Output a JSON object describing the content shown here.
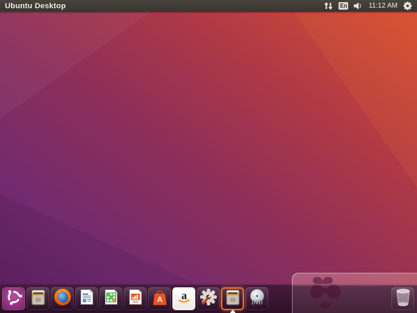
{
  "panel": {
    "title": "Ubuntu Desktop",
    "keyboard_layout": "En",
    "time": "11:12 AM",
    "bg_color": "#3C3833",
    "fg_color": "#F2F0EA"
  },
  "wallpaper": {
    "gradient_top_right": "#D8502F",
    "gradient_center": "#9B3355",
    "gradient_bottom_left": "#5E2160"
  },
  "launcher": {
    "bg_color": "#2C0F26",
    "accent_color": "#E95420",
    "software_letter": "A",
    "amazon_letter": "a",
    "dvd_text": "DVD",
    "items": [
      {
        "id": "dash-home"
      },
      {
        "id": "files"
      },
      {
        "id": "firefox"
      },
      {
        "id": "libreoffice-writer"
      },
      {
        "id": "libreoffice-calc"
      },
      {
        "id": "libreoffice-impress"
      },
      {
        "id": "ubuntu-software"
      },
      {
        "id": "amazon"
      },
      {
        "id": "system-settings"
      },
      {
        "id": "files",
        "active": true
      },
      {
        "id": "dvd"
      },
      {
        "id": "trash"
      }
    ]
  }
}
